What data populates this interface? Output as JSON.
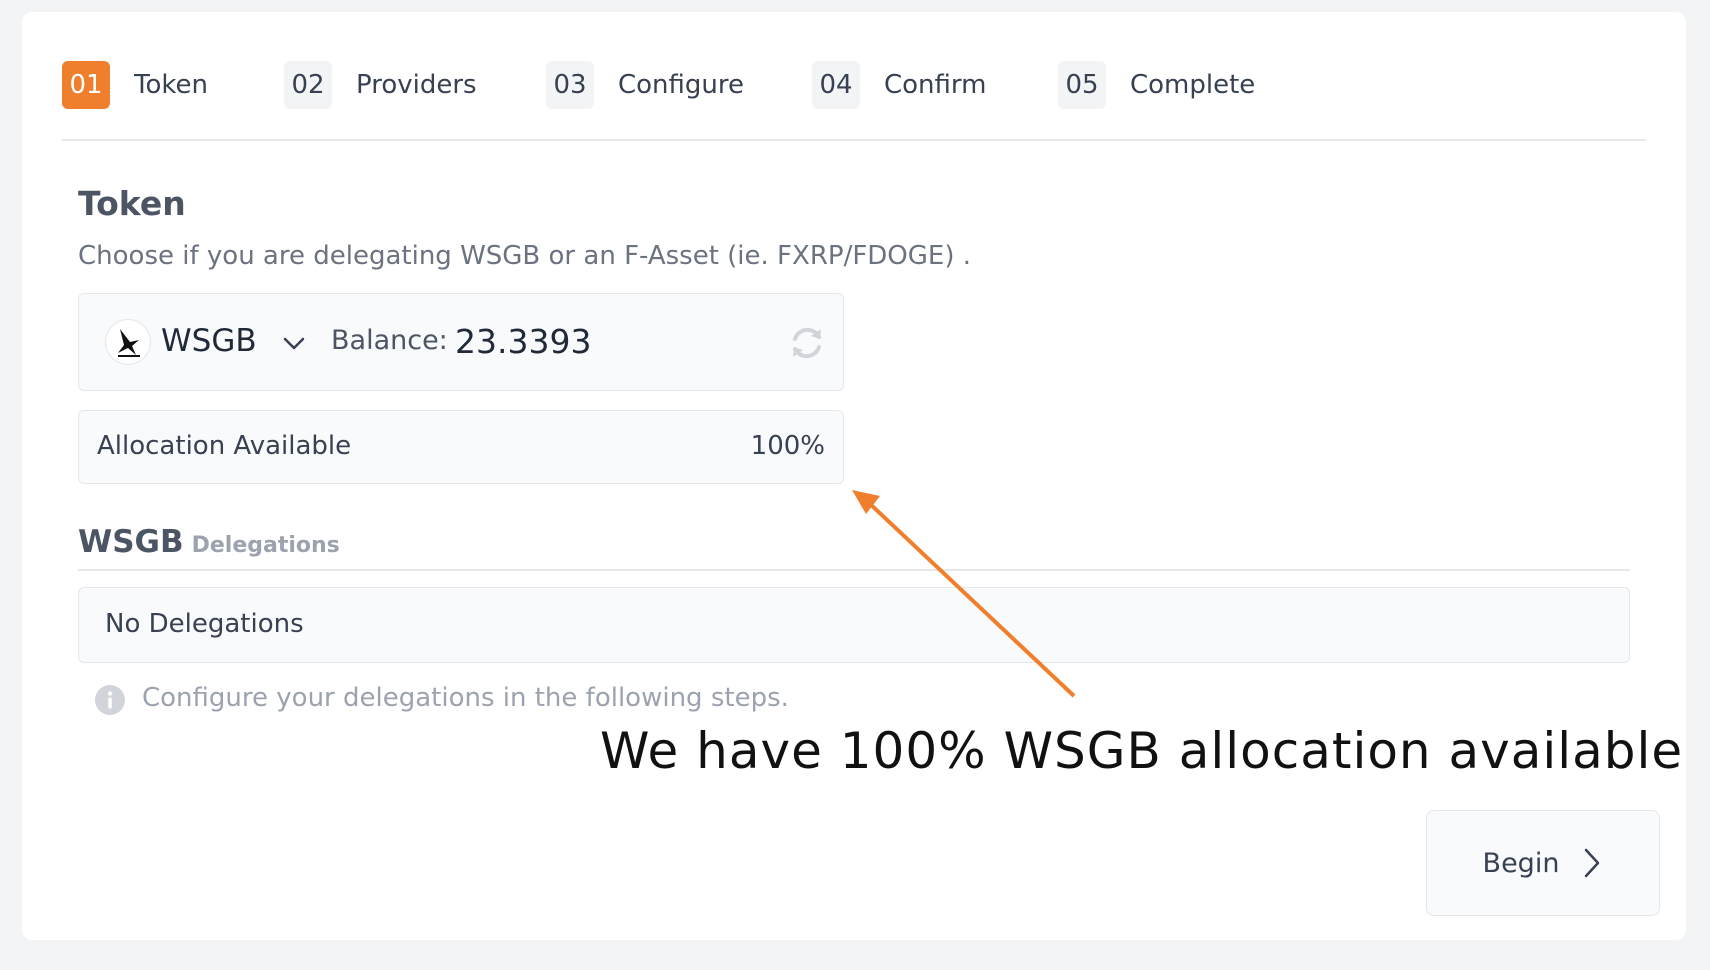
{
  "steps": [
    {
      "num": "01",
      "label": "Token",
      "active": true
    },
    {
      "num": "02",
      "label": "Providers",
      "active": false
    },
    {
      "num": "03",
      "label": "Configure",
      "active": false
    },
    {
      "num": "04",
      "label": "Confirm",
      "active": false
    },
    {
      "num": "05",
      "label": "Complete",
      "active": false
    }
  ],
  "section": {
    "title": "Token",
    "description": "Choose if you are delegating WSGB or an F-Asset (ie. FXRP/FDOGE) ."
  },
  "token_selector": {
    "symbol": "WSGB",
    "icon": "songbird-bird-icon",
    "balance_label": "Balance:",
    "balance_value": "23.3393"
  },
  "allocation": {
    "label": "Allocation Available",
    "value": "100%"
  },
  "delegations": {
    "token": "WSGB",
    "label": "Delegations",
    "empty_text": "No Delegations",
    "info_text": "Configure your delegations in the following steps."
  },
  "annotation": {
    "text": "We have 100% WSGB allocation available",
    "color": "#f07f2d"
  },
  "actions": {
    "begin_label": "Begin"
  },
  "colors": {
    "accent": "#f07f2d",
    "background": "#f3f4f6",
    "card": "#ffffff"
  }
}
